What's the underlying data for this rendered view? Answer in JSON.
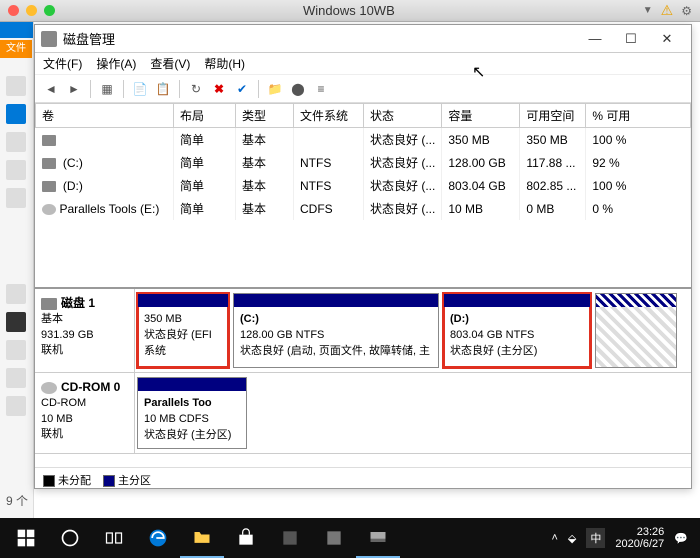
{
  "mac": {
    "title": "Windows 10WB"
  },
  "host": {
    "fileTab": "文件"
  },
  "dm": {
    "title": "磁盘管理",
    "menu": {
      "file": "文件(F)",
      "action": "操作(A)",
      "view": "查看(V)",
      "help": "帮助(H)"
    },
    "columns": {
      "volume": "卷",
      "layout": "布局",
      "type": "类型",
      "fs": "文件系统",
      "status": "状态",
      "capacity": "容量",
      "free": "可用空间",
      "pctfree": "% 可用"
    },
    "rows": [
      {
        "vol": "",
        "layout": "简单",
        "type": "基本",
        "fs": "",
        "status": "状态良好 (...",
        "cap": "350 MB",
        "free": "350 MB",
        "pct": "100 %"
      },
      {
        "vol": " (C:)",
        "layout": "简单",
        "type": "基本",
        "fs": "NTFS",
        "status": "状态良好 (...",
        "cap": "128.00 GB",
        "free": "117.88 ...",
        "pct": "92 %"
      },
      {
        "vol": " (D:)",
        "layout": "简单",
        "type": "基本",
        "fs": "NTFS",
        "status": "状态良好 (...",
        "cap": "803.04 GB",
        "free": "802.85 ...",
        "pct": "100 %"
      },
      {
        "vol": "Parallels Tools (E:)",
        "layout": "简单",
        "type": "基本",
        "fs": "CDFS",
        "status": "状态良好 (...",
        "cap": "10 MB",
        "free": "0 MB",
        "pct": "0 %",
        "cd": true
      }
    ],
    "graph": {
      "disk1": {
        "title": "磁盘 1",
        "type": "基本",
        "size": "931.39 GB",
        "state": "联机",
        "p1": {
          "size": "350 MB",
          "desc": "状态良好 (EFI 系统"
        },
        "p2": {
          "title": "(C:)",
          "size": "128.00 GB NTFS",
          "desc": "状态良好 (启动, 页面文件, 故障转储, 主"
        },
        "p3": {
          "title": "(D:)",
          "size": "803.04 GB NTFS",
          "desc": "状态良好 (主分区)"
        }
      },
      "cd0": {
        "title": "CD-ROM 0",
        "type": "CD-ROM",
        "size": "10 MB",
        "state": "联机",
        "p1": {
          "title": "Parallels Too",
          "size": "10 MB CDFS",
          "desc": "状态良好 (主分区)"
        }
      }
    },
    "legend": {
      "unalloc": "未分配",
      "primary": "主分区"
    }
  },
  "footer": {
    "count": "9 个"
  },
  "tray": {
    "ime": "中",
    "time": "23:26",
    "date": "2020/6/27"
  }
}
